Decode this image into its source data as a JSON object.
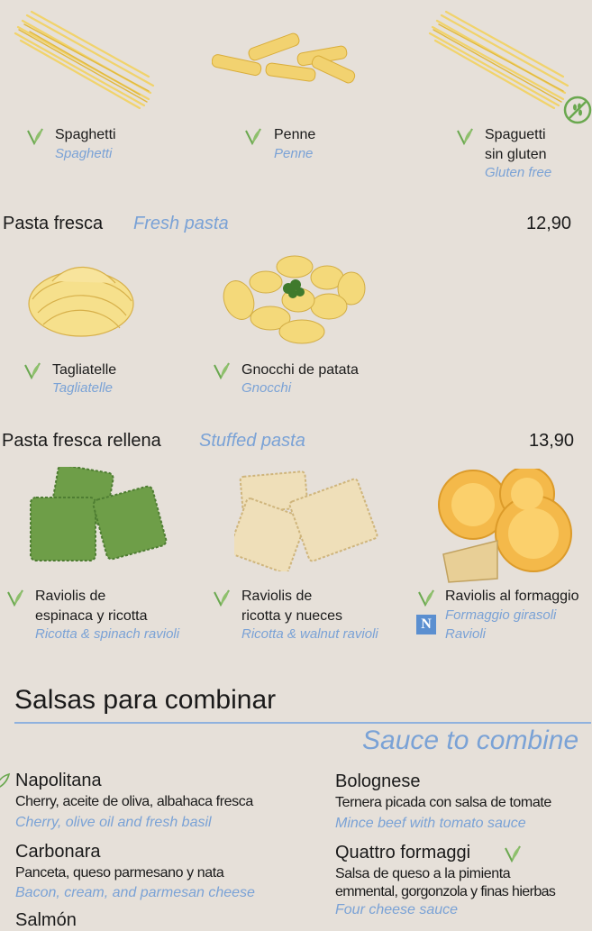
{
  "row1": [
    {
      "name": "Spaghetti",
      "en": "Spaghetti"
    },
    {
      "name": "Penne",
      "en": "Penne"
    },
    {
      "name_l1": "Spaguetti",
      "name_l2": "sin gluten",
      "en": "Gluten free"
    }
  ],
  "fresh": {
    "title": "Pasta fresca",
    "title_en": "Fresh pasta",
    "price": "12,90",
    "items": [
      {
        "name": "Tagliatelle",
        "en": "Tagliatelle"
      },
      {
        "name": "Gnocchi de patata",
        "en": "Gnocchi"
      }
    ]
  },
  "stuffed": {
    "title": "Pasta fresca rellena",
    "title_en": "Stuffed pasta",
    "price": "13,90",
    "items": [
      {
        "name_l1": "Raviolis de",
        "name_l2": "espinaca y ricotta",
        "en": "Ricotta & spinach ravioli"
      },
      {
        "name_l1": "Raviolis de",
        "name_l2": "ricotta y nueces",
        "en": "Ricotta & walnut ravioli"
      },
      {
        "name_l1": "Raviolis al formaggio",
        "en_l1": "Formaggio girasoli",
        "en_l2": "Ravioli",
        "badge": "N"
      }
    ]
  },
  "sauces": {
    "title": "Salsas para combinar",
    "title_en": "Sauce to combine",
    "items": [
      {
        "name": "Napolitana",
        "desc": "Cherry, aceite de oliva, albahaca fresca",
        "en": "Cherry, olive oil and fresh basil"
      },
      {
        "name": "Bolognese",
        "desc": "Ternera picada con salsa de tomate",
        "en": "Mince beef with tomato sauce"
      },
      {
        "name": "Carbonara",
        "desc": "Panceta, queso parmesano y nata",
        "en": "Bacon, cream, and parmesan cheese"
      },
      {
        "name": "Quattro formaggi",
        "desc_l1": "Salsa de queso a la pimienta",
        "desc_l2": "emmental, gorgonzola y finas hierbas",
        "en": "Four cheese sauce"
      },
      {
        "name": "Salmón"
      }
    ]
  },
  "icons": {
    "vegetarian": "leaf-v-icon",
    "gluten_free": "wheat-crossed-icon",
    "badge_n": "n-badge-icon"
  },
  "colors": {
    "background": "#e6e0d9",
    "english_text": "#7aa2d6",
    "veg_green": "#6aa84f"
  }
}
